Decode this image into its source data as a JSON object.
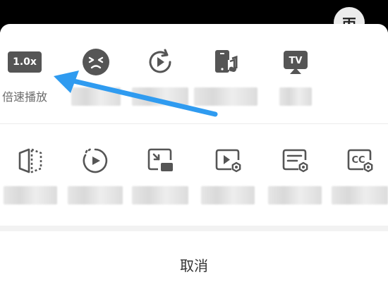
{
  "header": {
    "avatar_char": "丙"
  },
  "row1": {
    "items": [
      {
        "icon": "speed-1x-icon",
        "badge": "1.0x",
        "label": "倍速播放"
      },
      {
        "icon": "dislike-face-icon",
        "label": ""
      },
      {
        "icon": "auto-replay-icon",
        "label": ""
      },
      {
        "icon": "phone-music-icon",
        "label": ""
      },
      {
        "icon": "tv-cast-icon",
        "label": ""
      }
    ]
  },
  "row2": {
    "items": [
      {
        "icon": "mirror-flip-icon",
        "label": ""
      },
      {
        "icon": "timer-play-icon",
        "label": ""
      },
      {
        "icon": "pip-icon",
        "label": ""
      },
      {
        "icon": "video-settings-icon",
        "label": ""
      },
      {
        "icon": "subtitle-settings-icon",
        "label": ""
      },
      {
        "icon": "cc-settings-icon",
        "label": ""
      }
    ]
  },
  "footer": {
    "cancel_label": "取消"
  },
  "colors": {
    "icon_dark": "#555555",
    "arrow_blue": "#2f9bf0",
    "text_gray": "#6b6b6b"
  }
}
